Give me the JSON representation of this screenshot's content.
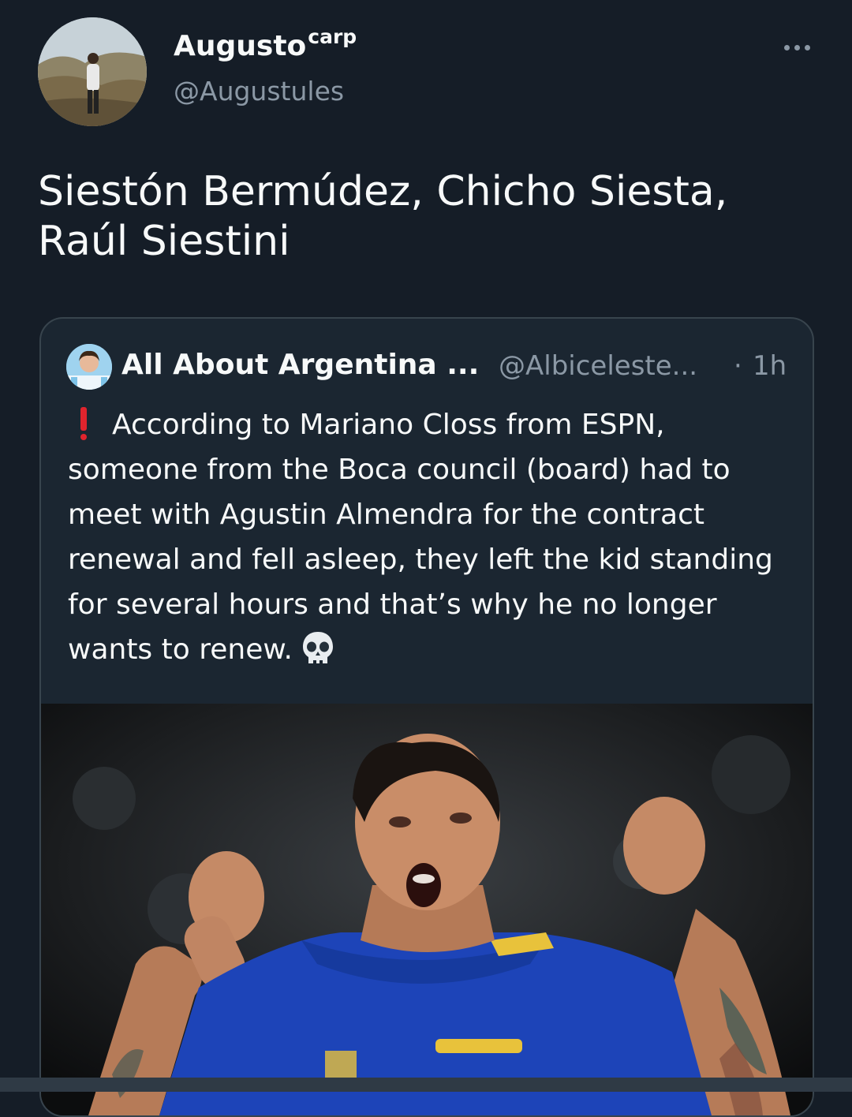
{
  "author": {
    "display_name": "Augusto",
    "display_name_suffix": "carp",
    "handle": "@Augustules",
    "avatar_icon": "profile-photo"
  },
  "more_icon": "more-horizontal-icon",
  "tweet": {
    "text": "Siestón Bermúdez, Chicho Siesta, Raúl Siestini"
  },
  "quoted": {
    "name": "All About Argentina ...",
    "handle": "@Albiceleste...",
    "separator": "·",
    "time": "1h",
    "text": "According to Mariano Closs from ESPN, someone from the Boca council (board) had to meet with Agustin Almendra for the contract renewal and fell asleep, they left the kid standing for several hours and that’s why he no longer wants to renew.",
    "leading_emoji": "exclamation-icon",
    "trailing_emoji": "skull-icon",
    "photo": "footballer-celebrating-photo"
  },
  "colors": {
    "background": "#151d27",
    "card_border": "#38444d",
    "text_primary": "#f7f9f9",
    "text_secondary": "#8b98a5"
  }
}
